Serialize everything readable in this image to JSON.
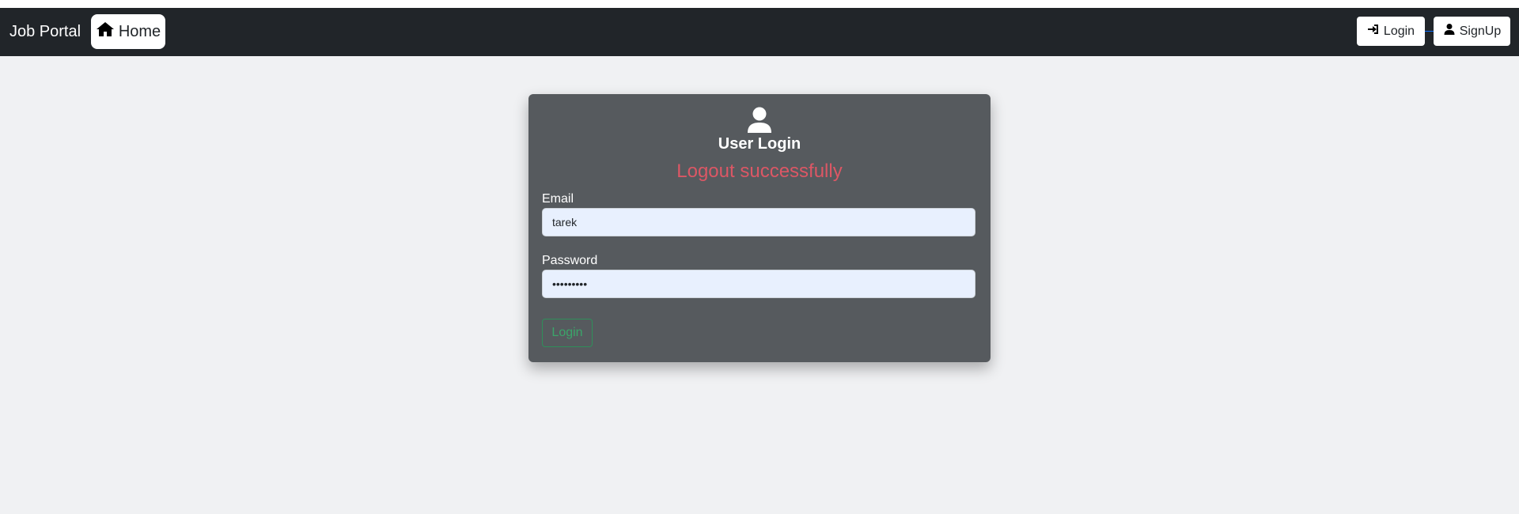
{
  "navbar": {
    "brand": "Job Portal",
    "home_label": "Home",
    "home_icon": "home-icon",
    "login_label": "Login",
    "login_icon": "sign-in-icon",
    "signup_label": "SignUp",
    "signup_icon": "user-icon"
  },
  "login_card": {
    "icon": "user-icon",
    "title": "User Login",
    "message": "Logout successfully",
    "email_label": "Email",
    "email_value": "tarek",
    "password_label": "Password",
    "password_value": "*********",
    "submit_label": "Login"
  },
  "colors": {
    "navbar": "#212529",
    "card": "#565a5e",
    "message": "#dc5765",
    "button_outline": "#2f8f5a",
    "input_bg": "#e8f0fe",
    "page_bg": "#f0f1f3"
  }
}
